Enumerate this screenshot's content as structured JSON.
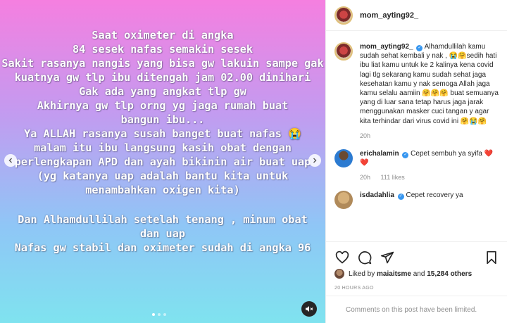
{
  "post": {
    "lines_block1": [
      "Saat oximeter di angka",
      "84 sesek nafas semakin sesek",
      "Sakit rasanya nangis yang bisa gw lakuin sampe gak",
      "kuatnya gw tlp ibu ditengah jam 02.00 dinihari",
      "Gak ada yang angkat tlp gw",
      "Akhirnya gw tlp orng yg jaga rumah buat",
      "bangun ibu...",
      "Ya ALLAH rasanya susah banget buat  nafas 😭",
      "malam itu ibu langsung kasih obat dengan",
      "perlengkapan APD dan ayah bikinin air buat uap",
      "(yg katanya uap adalah bantu kita untuk",
      "menambahkan oxigen kita)"
    ],
    "lines_block2": [
      "Dan Alhamdullilah setelah tenang , minum obat",
      "dan uap",
      "Nafas gw stabil dan oximeter sudah di angka 96"
    ],
    "nav_prev_icon": "chevron-left-icon",
    "nav_next_icon": "chevron-right-icon",
    "mute_icon": "speaker-muted-icon",
    "gradient_colors": [
      "#f57fe0",
      "#c39bf0",
      "#8fc6f6",
      "#7fe3ef"
    ]
  },
  "header": {
    "username": "mom_ayting92_",
    "more_icon": "more-horizontal-icon"
  },
  "caption": {
    "username": "mom_ayting92_",
    "text": "Alhamdullilah kamu sudah sehat kembali y nak , 😭🤗sedih hati ibu liat kamu untuk ke 2 kalinya kena covid lagi tlg sekarang kamu sudah sehat jaga kesehatan kamu y nak semoga Allah jaga kamu selalu aamiin 🤗🤗🤗 buat semuanya yang di luar sana tetap harus jaga jarak menggunakan masker cuci tangan y agar kita terhindar dari virus covid ini 🤗😭🤗",
    "time": "20h"
  },
  "comments": [
    {
      "username": "erichalamin",
      "verified": true,
      "text": "Cepet sembuh ya syifa ❤️❤️",
      "time": "20h",
      "likes": "111 likes"
    },
    {
      "username": "isdadahlia",
      "verified": true,
      "text": "Cepet recovery ya"
    }
  ],
  "actions": {
    "like_icon": "heart-icon",
    "comment_icon": "comment-icon",
    "share_icon": "send-icon",
    "save_icon": "bookmark-icon"
  },
  "likes_line": {
    "prefix": "Liked by ",
    "user": "maiaitsme",
    "middle": " and ",
    "count": "15,284 others"
  },
  "timestamp": "20 HOURS AGO",
  "comments_limited": "Comments on this post have been limited.",
  "colors": {
    "verified": "#3897f0",
    "heart": "#e0245e",
    "muted_text": "#8e8e8e"
  }
}
